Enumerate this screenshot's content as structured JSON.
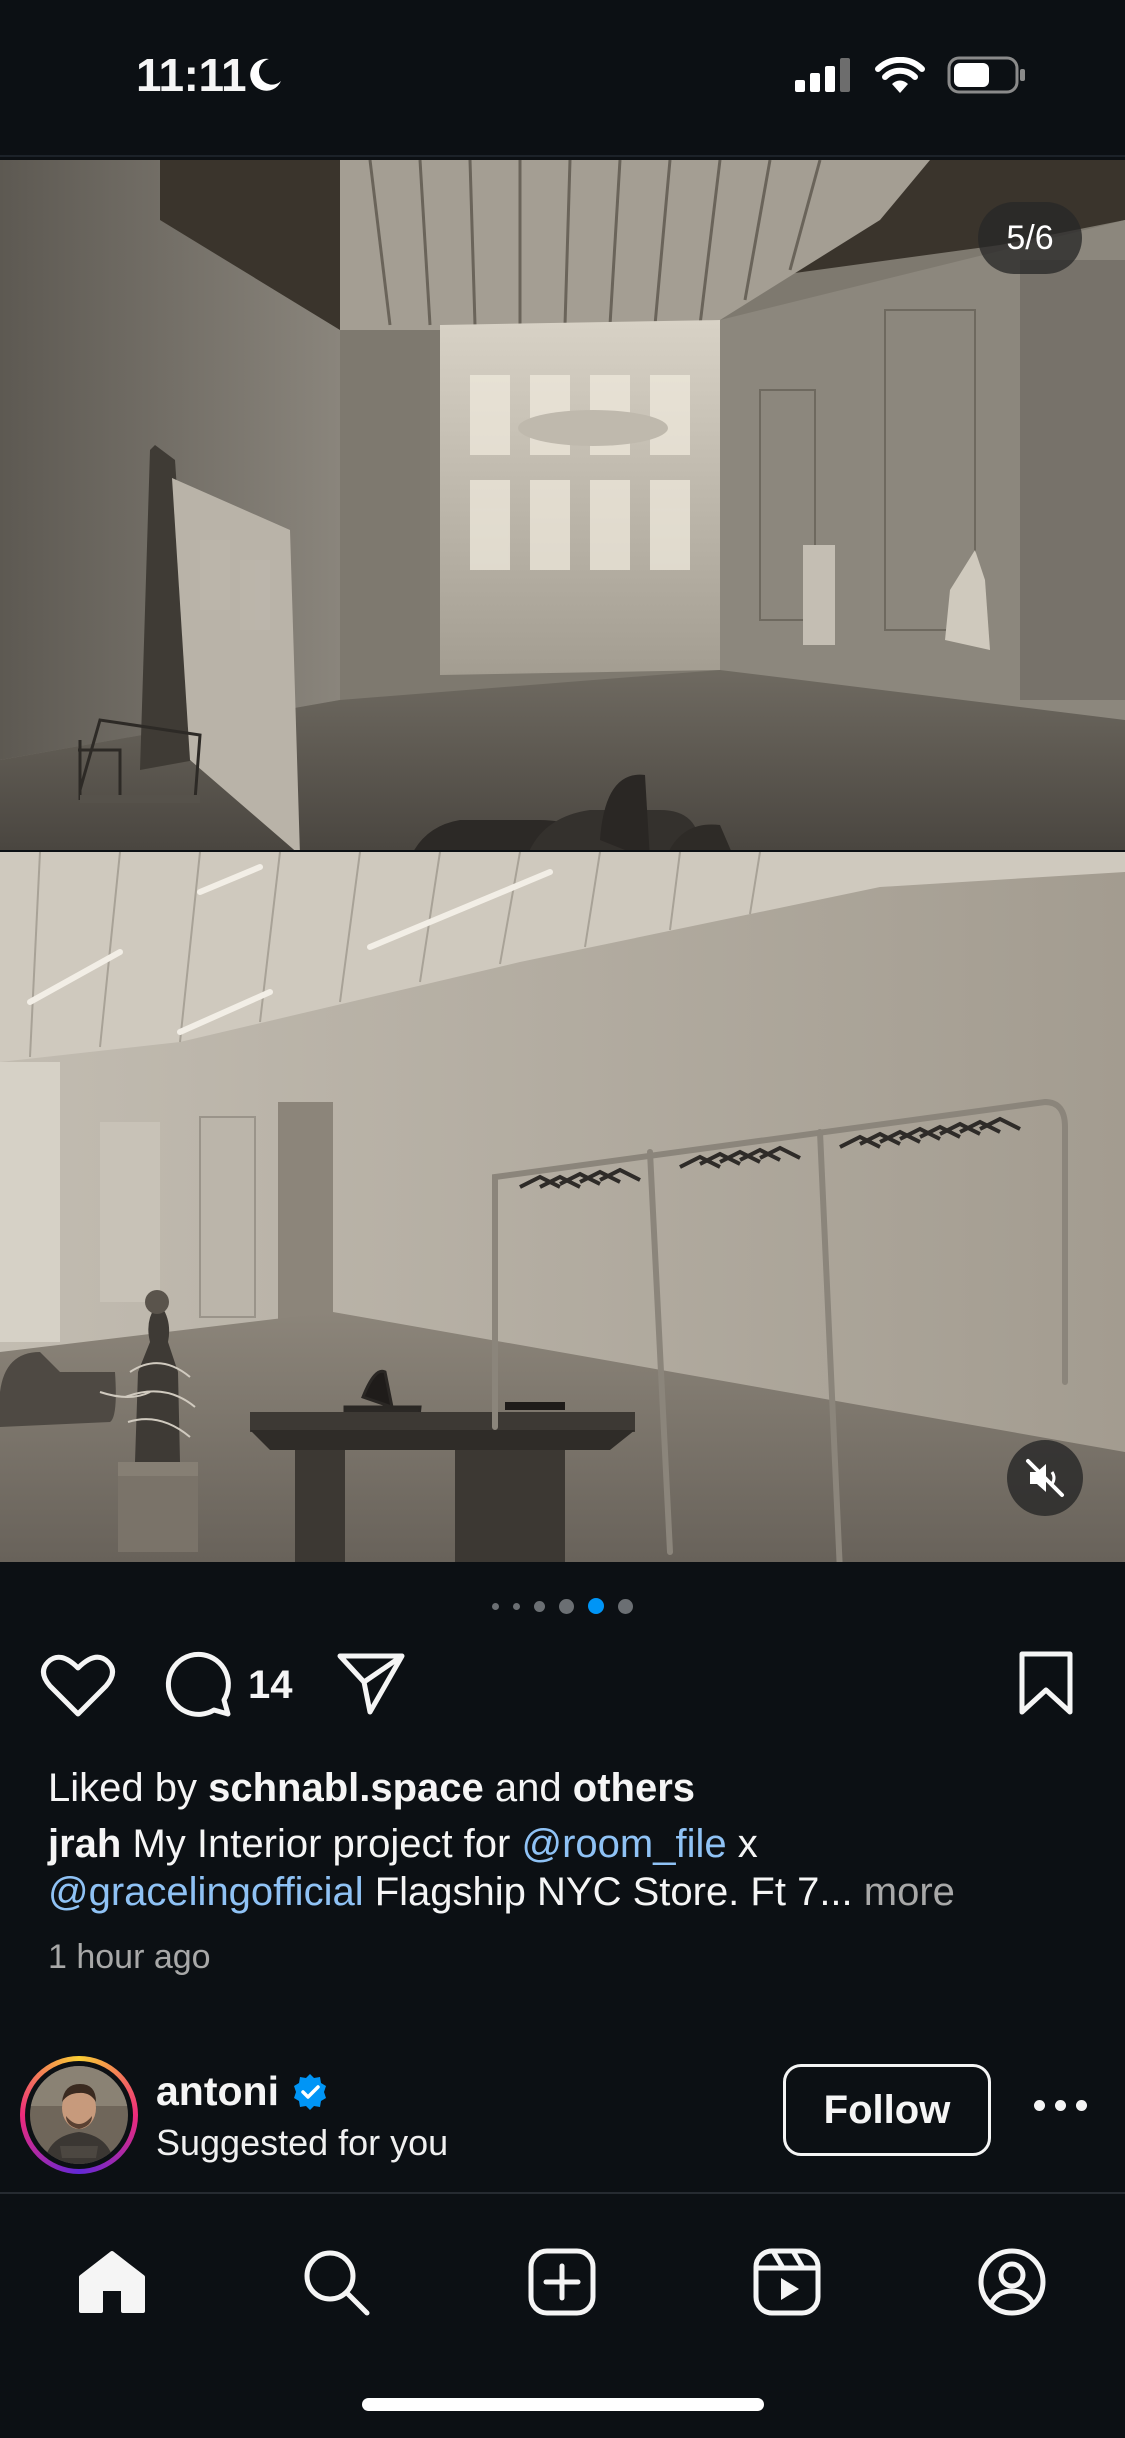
{
  "status_bar": {
    "time": "11:11",
    "battery_level": 0.6
  },
  "post": {
    "slide_counter": "5/6",
    "carousel": {
      "total": 6,
      "active_index": 4
    },
    "comment_count": "14",
    "liked_by": {
      "prefix": "Liked by ",
      "user": "schnabl.space",
      "middle": " and ",
      "others": "others"
    },
    "caption": {
      "author": "jrah",
      "text_1": " My Interior project for ",
      "mention_1": "@room_file",
      "text_2": " x ",
      "mention_2": "@gracelingofficial",
      "text_3": " Flagship NYC Store. Ft 7...",
      "more_label": " more"
    },
    "time_ago": "1 hour ago"
  },
  "suggestion": {
    "username": "antoni",
    "verified": true,
    "subtitle": "Suggested for you",
    "follow_label": "Follow"
  },
  "colors": {
    "background": "#0c1014",
    "accent": "#0095f6",
    "mention": "#8fc2f5",
    "muted": "#a8a8a8"
  },
  "icons": [
    "moon-icon",
    "signal-icon",
    "wifi-icon",
    "battery-icon",
    "mute-icon",
    "heart-icon",
    "comment-icon",
    "share-icon",
    "bookmark-icon",
    "verified-icon",
    "more-icon",
    "home-icon",
    "search-icon",
    "create-icon",
    "reels-icon",
    "profile-icon"
  ]
}
